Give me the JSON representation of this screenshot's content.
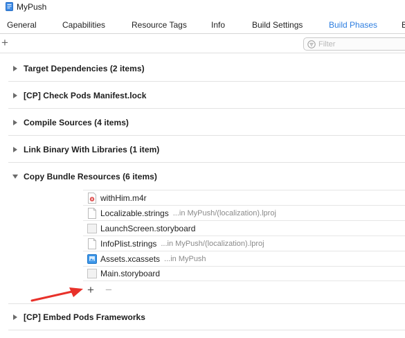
{
  "window": {
    "project_name": "MyPush"
  },
  "tabs": [
    {
      "label": "General",
      "active": false
    },
    {
      "label": "Capabilities",
      "active": false
    },
    {
      "label": "Resource Tags",
      "active": false
    },
    {
      "label": "Info",
      "active": false
    },
    {
      "label": "Build Settings",
      "active": false
    },
    {
      "label": "Build Phases",
      "active": true
    },
    {
      "label": "B",
      "active": false
    }
  ],
  "toolbar": {
    "add_phase_icon": "+",
    "filter_placeholder": "Filter"
  },
  "phases": [
    {
      "title": "Target Dependencies (2 items)",
      "expanded": false
    },
    {
      "title": "[CP] Check Pods Manifest.lock",
      "expanded": false
    },
    {
      "title": "Compile Sources (4 items)",
      "expanded": false
    },
    {
      "title": "Link Binary With Libraries (1 item)",
      "expanded": false
    },
    {
      "title": "Copy Bundle Resources (6 items)",
      "expanded": true
    },
    {
      "title": "[CP] Embed Pods Frameworks",
      "expanded": false
    }
  ],
  "resources": [
    {
      "name": "withHim.m4r",
      "path": "",
      "icon": "audio-file-icon"
    },
    {
      "name": "Localizable.strings",
      "path": "...in MyPush/(localization).lproj",
      "icon": "strings-file-icon"
    },
    {
      "name": "LaunchScreen.storyboard",
      "path": "",
      "icon": "storyboard-file-icon"
    },
    {
      "name": "InfoPlist.strings",
      "path": "...in MyPush/(localization).lproj",
      "icon": "strings-file-icon"
    },
    {
      "name": "Assets.xcassets",
      "path": "...in MyPush",
      "icon": "asset-catalog-icon"
    },
    {
      "name": "Main.storyboard",
      "path": "",
      "icon": "storyboard-file-icon"
    }
  ],
  "resource_controls": {
    "add": "+",
    "remove": "−"
  },
  "colors": {
    "accent": "#2d7ee0",
    "annotation_arrow": "#e8312a"
  }
}
